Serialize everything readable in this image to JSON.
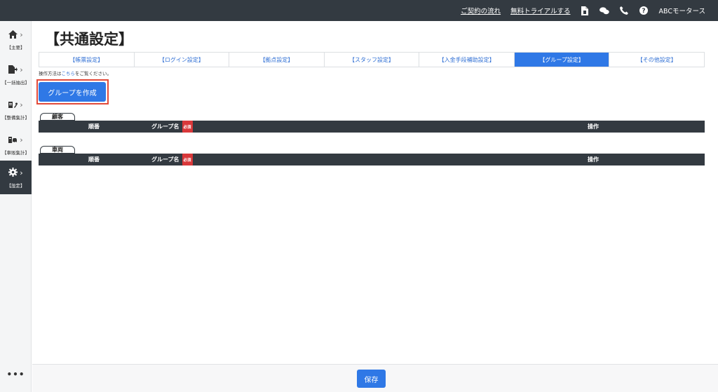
{
  "topbar": {
    "contract_flow": "ご契約の流れ",
    "free_trial": "無料トライアルする",
    "user_name": "ABCモータース"
  },
  "sidebar": {
    "items": [
      {
        "label": "【主要】",
        "icon": "home-icon"
      },
      {
        "label": "【一括抽出】",
        "icon": "file-export-icon"
      },
      {
        "label": "【整備集計】",
        "icon": "wrench-icon"
      },
      {
        "label": "【車販集計】",
        "icon": "car-icon"
      },
      {
        "label": "【設定】",
        "icon": "gear-icon"
      }
    ],
    "more": "•••"
  },
  "page": {
    "title": "【共通設定】",
    "help_prefix": "操作方法は",
    "help_link": "こちら",
    "help_suffix": "をご覧ください。",
    "create_button": "グループを作成"
  },
  "tabs": [
    {
      "label": "【帳票設定】"
    },
    {
      "label": "【ログイン設定】"
    },
    {
      "label": "【拠点設定】"
    },
    {
      "label": "【スタッフ設定】"
    },
    {
      "label": "【入金手段補助設定】"
    },
    {
      "label": "【グループ設定】"
    },
    {
      "label": "【その他設定】"
    }
  ],
  "sections": [
    {
      "label": "顧客",
      "columns": {
        "order": "順番",
        "name": "グループ名",
        "required": "必須",
        "action": "操作"
      }
    },
    {
      "label": "車両",
      "columns": {
        "order": "順番",
        "name": "グループ名",
        "required": "必須",
        "action": "操作"
      }
    }
  ],
  "footer": {
    "save_button": "保存"
  },
  "colors": {
    "accent": "#2f78e6",
    "dark": "#333a41",
    "highlight": "#e24a3a",
    "required": "#d9383a"
  }
}
